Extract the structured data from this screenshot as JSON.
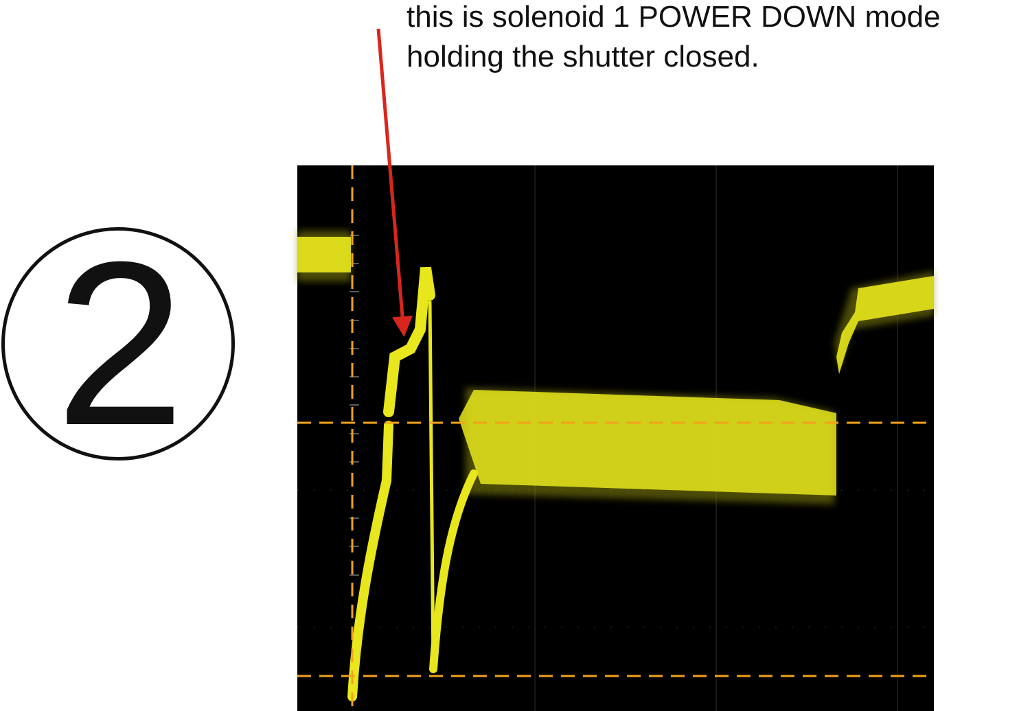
{
  "annotation": {
    "line1": "this is solenoid 1 POWER DOWN mode",
    "line2": "holding the shutter closed."
  },
  "step_marker": {
    "number": "2"
  },
  "colors": {
    "screen_background": "#000000",
    "trace": "#e8e61c",
    "trace_glow": "#8a8a10",
    "cursor": "#f2a31a",
    "graticule": "#3a3a3a",
    "arrow": "#d9261c",
    "text": "#111111"
  },
  "icons": {
    "marker": "circled-number-icon",
    "pointer": "red-arrow-icon"
  }
}
